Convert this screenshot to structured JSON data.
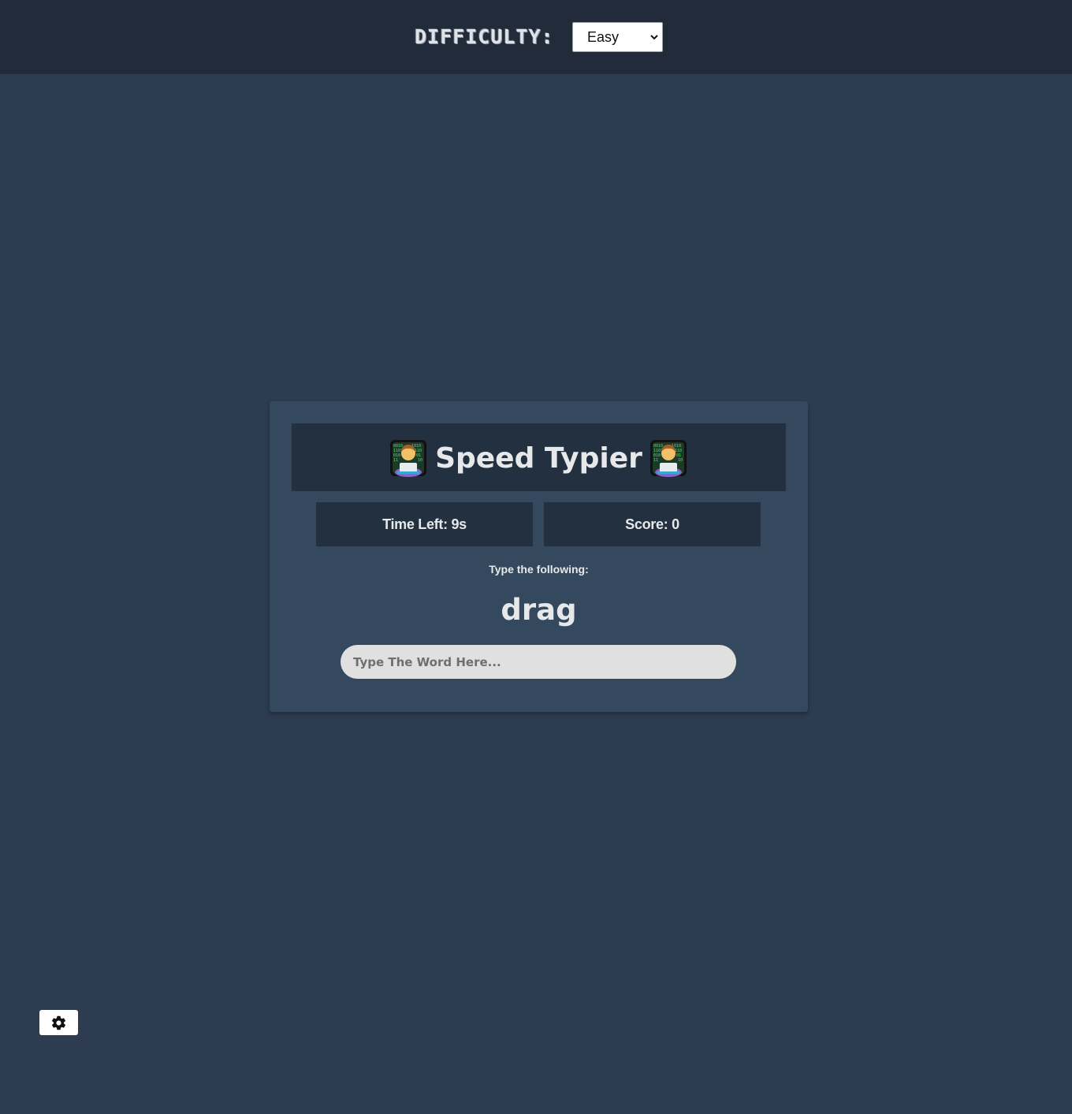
{
  "header": {
    "difficulty_label": "DIFFICULTY:",
    "difficulty_selected": "Easy"
  },
  "game": {
    "title": "Speed Typier",
    "title_icon": "technologist-emoji-icon",
    "time_left": "Time Left: 9s",
    "score": "Score: 0",
    "prompt_label": "Type the following:",
    "word": "drag",
    "input_value": "",
    "input_placeholder": "Type The Word Here..."
  },
  "settings": {
    "icon": "gear-icon"
  },
  "colors": {
    "background": "#2d3c50",
    "topbar": "#212b3a",
    "card": "#34495e",
    "panel": "#22303f",
    "text": "#e6e8ea",
    "input_bg": "#e0e0e0"
  }
}
